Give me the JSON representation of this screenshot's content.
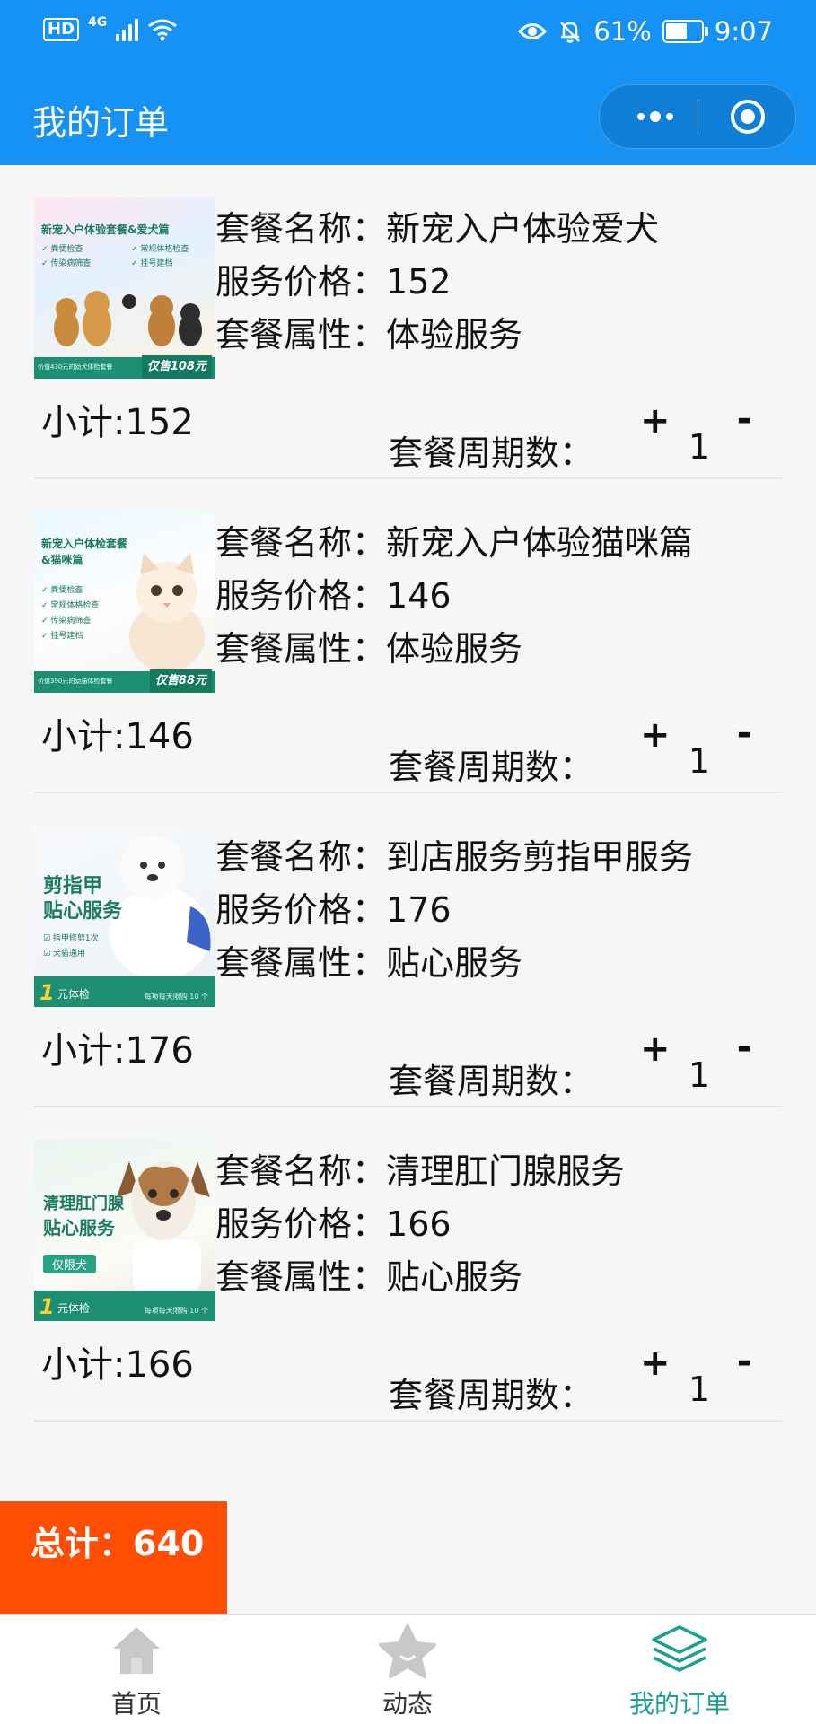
{
  "status_bar": {
    "hd": "HD",
    "network": "4G",
    "battery_percent": "61%",
    "battery_level": 0.61,
    "time": "9:07"
  },
  "header": {
    "title": "我的订单"
  },
  "orders": [
    {
      "name_label": "套餐名称：",
      "name": "新宠入户体验爱犬",
      "price_label": "服务价格：",
      "price": "152",
      "type_label": "套餐属性：",
      "type": "体验服务",
      "subtotal": "小计:152",
      "cycle_label": "套餐周期数：",
      "plus": "+",
      "quantity": "1",
      "minus": "-",
      "thumb": {
        "header_line1": "新宠入户体验套餐&爱犬篇",
        "checks": [
          "✓ 粪便检查",
          "✓ 常规体格检查",
          "✓ 传染病筛查",
          "✓ 挂号建档"
        ],
        "footer_note": "价值430元的幼犬体检套餐",
        "sale": "仅售108元"
      }
    },
    {
      "name_label": "套餐名称：",
      "name": "新宠入户体验猫咪篇",
      "price_label": "服务价格：",
      "price": "146",
      "type_label": "套餐属性：",
      "type": "体验服务",
      "subtotal": "小计:146",
      "cycle_label": "套餐周期数：",
      "plus": "+",
      "quantity": "1",
      "minus": "-",
      "thumb": {
        "header_line1": "新宠入户体检套餐",
        "header_line2": "&猫咪篇",
        "checks": [
          "✓ 粪便检查",
          "✓ 常规体格检查",
          "✓ 传染病筛查",
          "✓ 挂号建档"
        ],
        "footer_note": "价值390元的幼猫体检套餐",
        "sale": "仅售88元"
      }
    },
    {
      "name_label": "套餐名称：",
      "name": "到店服务剪指甲服务",
      "price_label": "服务价格：",
      "price": "176",
      "type_label": "套餐属性：",
      "type": "贴心服务",
      "subtotal": "小计:176",
      "cycle_label": "套餐周期数：",
      "plus": "+",
      "quantity": "1",
      "minus": "-",
      "thumb": {
        "big_line1": "剪指甲",
        "big_line2": "贴心服务",
        "checks": [
          "☑ 指甲修剪1次",
          "☑ 犬猫通用"
        ],
        "one": "1",
        "one_text": "元体检",
        "limit": "每项每天限购 10 个"
      }
    },
    {
      "name_label": "套餐名称：",
      "name": "清理肛门腺服务",
      "price_label": "服务价格：",
      "price": "166",
      "type_label": "套餐属性：",
      "type": "贴心服务",
      "subtotal": "小计:166",
      "cycle_label": "套餐周期数：",
      "plus": "+",
      "quantity": "1",
      "minus": "-",
      "thumb": {
        "big_line1": "清理肛门腺",
        "big_line2": "贴心服务",
        "pill": "仅限犬",
        "one": "1",
        "one_text": "元体检",
        "limit": "每项每天限购 10 个"
      }
    }
  ],
  "total": {
    "text": "总计：640"
  },
  "tabbar": {
    "items": [
      {
        "label": "首页",
        "icon": "home-icon",
        "active": false
      },
      {
        "label": "动态",
        "icon": "star-icon",
        "active": false
      },
      {
        "label": "我的订单",
        "icon": "layers-icon",
        "active": true
      }
    ]
  },
  "colors": {
    "header_bg": "#1692f5",
    "total_bg": "#ff4d03",
    "tab_active": "#1ba191",
    "tab_inactive_icon": "#c8c8c8"
  }
}
